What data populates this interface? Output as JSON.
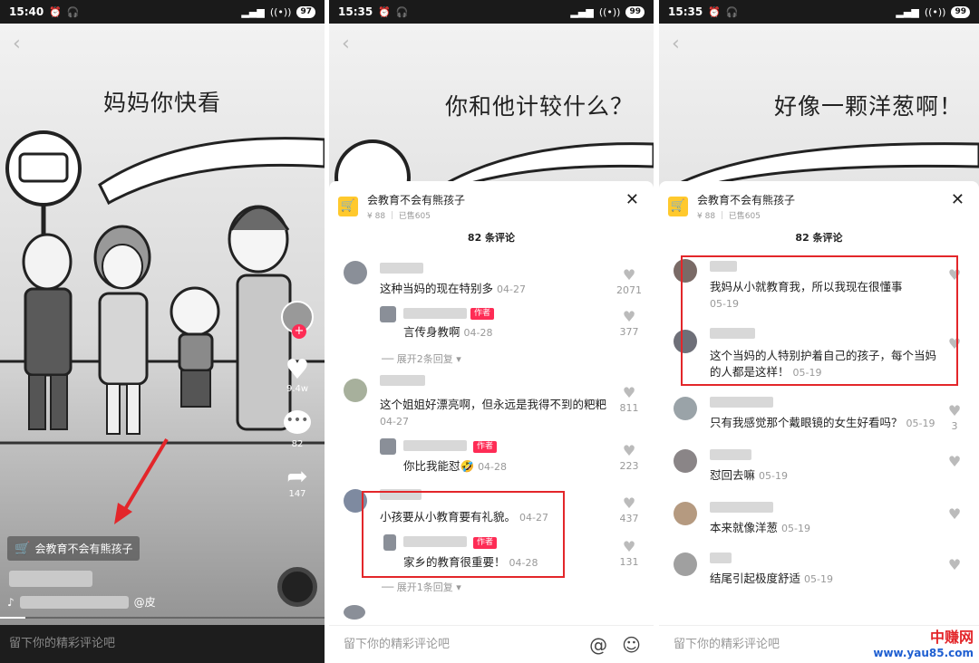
{
  "panel1": {
    "time": "15:40",
    "battery": "97",
    "caption": "妈妈你快看",
    "likes": "9.4w",
    "comments": "82",
    "shares": "147",
    "cart_label": "会教育不会有熊孩子",
    "mention": "@皮",
    "input_placeholder": "留下你的精彩评论吧"
  },
  "panel2": {
    "time": "15:35",
    "battery": "99",
    "caption": "你和他计较什么？",
    "product_name": "会教育不会有熊孩子",
    "product_meta": "¥ 88 ｜ 已售605",
    "comment_count": "82 条评论",
    "comments": [
      {
        "text": "这种当妈的现在特别多",
        "date": "04-27",
        "likes": "2071"
      },
      {
        "text": "言传身教啊",
        "date": "04-28",
        "likes": "377",
        "author_tag": "作者"
      },
      {
        "text": "这个姐姐好漂亮啊，但永远是我得不到的粑粑",
        "date": "04-27",
        "likes": "811"
      },
      {
        "text": "你比我能怼🤣",
        "date": "04-28",
        "likes": "223",
        "author_tag": "作者"
      },
      {
        "text": "小孩要从小教育要有礼貌。",
        "date": "04-27",
        "likes": "437"
      },
      {
        "text": "家乡的教育很重要！",
        "date": "04-28",
        "likes": "131",
        "author_tag": "作者"
      }
    ],
    "expand1": "展开2条回复",
    "expand2": "展开1条回复",
    "input_placeholder": "留下你的精彩评论吧"
  },
  "panel3": {
    "time": "15:35",
    "battery": "99",
    "caption": "好像一颗洋葱啊！",
    "product_name": "会教育不会有熊孩子",
    "product_meta": "¥ 88 ｜ 已售605",
    "comment_count": "82 条评论",
    "comments": [
      {
        "text": "我妈从小就教育我，所以我现在很懂事",
        "date": "05-19",
        "likes": ""
      },
      {
        "text": "这个当妈的人特别护着自己的孩子，每个当妈的人都是这样！",
        "date": "05-19",
        "likes": ""
      },
      {
        "text": "只有我感觉那个戴眼镜的女生好看吗？",
        "date": "05-19",
        "likes": "3"
      },
      {
        "text": "怼回去嘛",
        "date": "05-19",
        "likes": ""
      },
      {
        "text": "本来就像洋葱",
        "date": "05-19",
        "likes": ""
      },
      {
        "text": "结尾引起极度舒适",
        "date": "05-19",
        "likes": ""
      }
    ],
    "input_placeholder": "留下你的精彩评论吧"
  },
  "watermark": {
    "line1": "中赚网",
    "line2": "www.yau85.com"
  },
  "colors": {
    "accent": "#fe2c55",
    "highlight": "#e3262a",
    "cart": "#ffc92d"
  }
}
